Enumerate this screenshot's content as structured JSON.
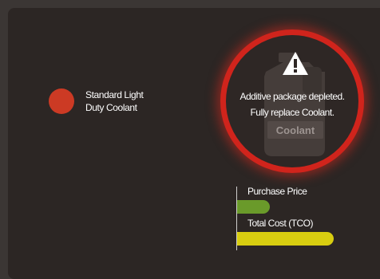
{
  "legend": {
    "label_line1": "Standard Light",
    "label_line2": "Duty Coolant",
    "color": "#cc3a24"
  },
  "alert": {
    "icon": "warning-icon",
    "line1": "Additive package depleted.",
    "line2": "Fully replace Coolant.",
    "ring_color": "#d0241c",
    "product_label": "Coolant"
  },
  "chart_data": {
    "type": "bar",
    "categories": [
      "Purchase Price",
      "Total Cost (TCO)"
    ],
    "values": [
      0.34,
      1.0
    ],
    "colors": [
      "#6a9a2a",
      "#d8cd10"
    ]
  }
}
